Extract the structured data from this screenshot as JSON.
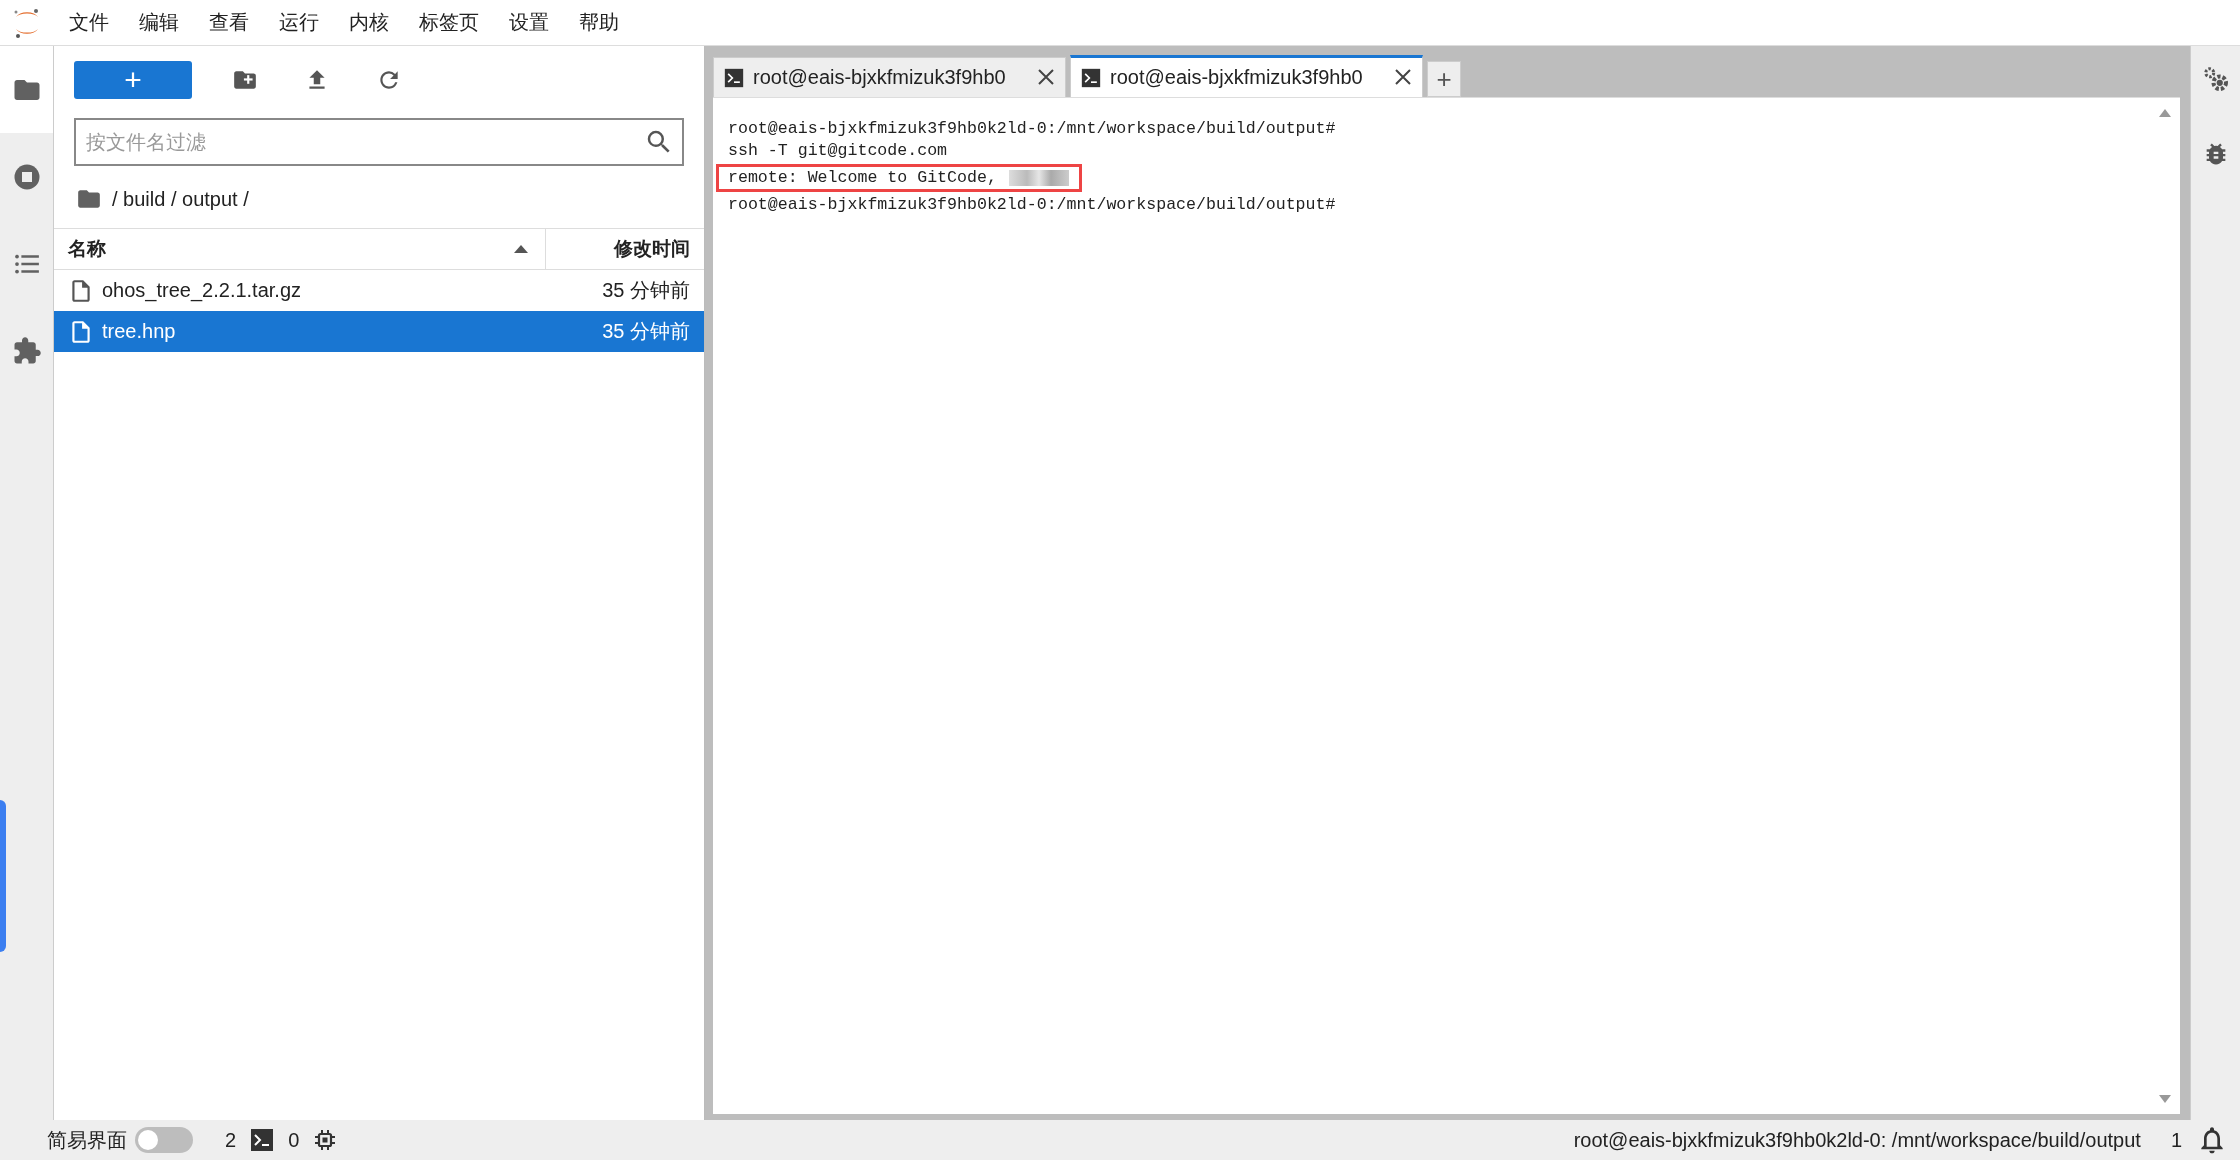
{
  "menu": [
    "文件",
    "编辑",
    "查看",
    "运行",
    "内核",
    "标签页",
    "设置",
    "帮助"
  ],
  "left_sidebar": [
    {
      "kind": "files",
      "selected": true
    },
    {
      "kind": "running",
      "selected": false
    },
    {
      "kind": "toc",
      "selected": false
    },
    {
      "kind": "extensions",
      "selected": false
    }
  ],
  "file_browser": {
    "new_button": "+",
    "filter": {
      "placeholder": "按文件名过滤"
    },
    "breadcrumb": "/ build / output /",
    "columns": [
      {
        "label": "名称",
        "sorted": true
      },
      {
        "label": "修改时间",
        "sorted": false
      }
    ],
    "rows": [
      {
        "name": "ohos_tree_2.2.1.tar.gz",
        "modified": "35 分钟前",
        "selected": false
      },
      {
        "name": "tree.hnp",
        "modified": "35 分钟前",
        "selected": true
      }
    ]
  },
  "terminal_tabs": [
    {
      "title": "root@eais-bjxkfmizuk3f9hb0",
      "selected": false
    },
    {
      "title": "root@eais-bjxkfmizuk3f9hb0",
      "selected": true
    }
  ],
  "new_tab_button": "+",
  "terminal": {
    "lines": [
      {
        "text": "root@eais-bjxkfmizuk3f9hb0k2ld-0:/mnt/workspace/build/output#",
        "redacted": false,
        "highlighted": false
      },
      {
        "text": "ssh -T git@gitcode.com",
        "redacted": false,
        "highlighted": false
      },
      {
        "text": "remote: Welcome to GitCode,",
        "redacted": true,
        "highlighted": true
      },
      {
        "text": "root@eais-bjxkfmizuk3f9hb0k2ld-0:/mnt/workspace/build/output#",
        "redacted": false,
        "highlighted": false
      }
    ]
  },
  "status_bar": {
    "simple_mode": {
      "label": "简易界面",
      "on": false
    },
    "terminals": "2",
    "kernels": "0",
    "path": "root@eais-bjxkfmizuk3f9hb0k2ld-0: /mnt/workspace/build/output",
    "notifications": "1"
  }
}
